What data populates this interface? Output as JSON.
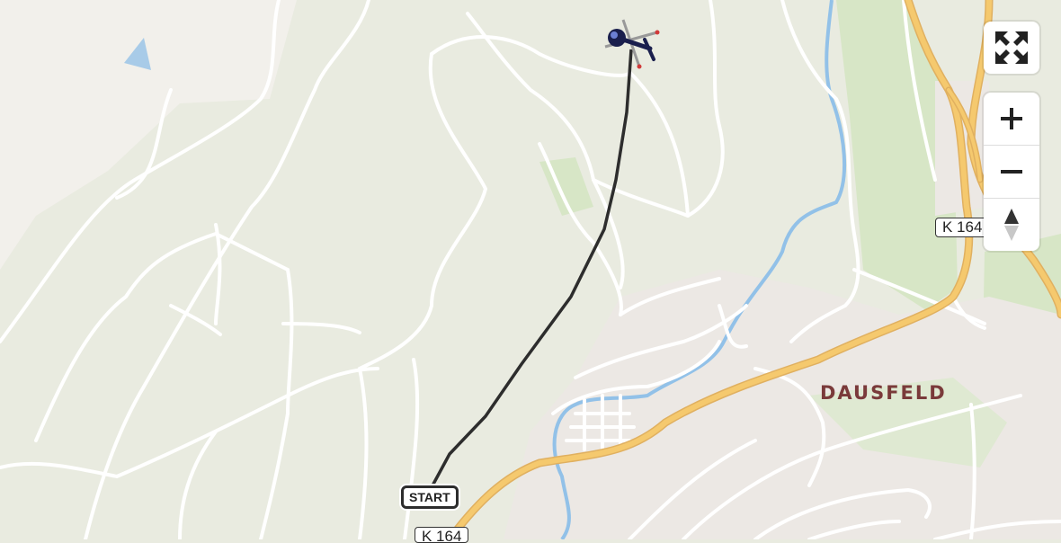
{
  "map": {
    "place_label": "DAUSFELD",
    "road_labels": [
      "K 164",
      "K 164"
    ],
    "start_label": "START",
    "colors": {
      "forest": "#e9ebe0",
      "meadow_green": "#d7e6c6",
      "open_land": "#f2f0eb",
      "residential": "#ece8e4",
      "road_major": "#f5c96e",
      "road_minor": "#ffffff",
      "water": "#92c1e8",
      "route": "#2d2d2d"
    }
  },
  "controls": {
    "fullscreen_icon": "expand-arrows-icon",
    "zoom_in_icon": "plus-icon",
    "zoom_out_icon": "minus-icon",
    "compass_icon": "north-arrow-icon"
  },
  "aircraft_icon": "helicopter-icon"
}
